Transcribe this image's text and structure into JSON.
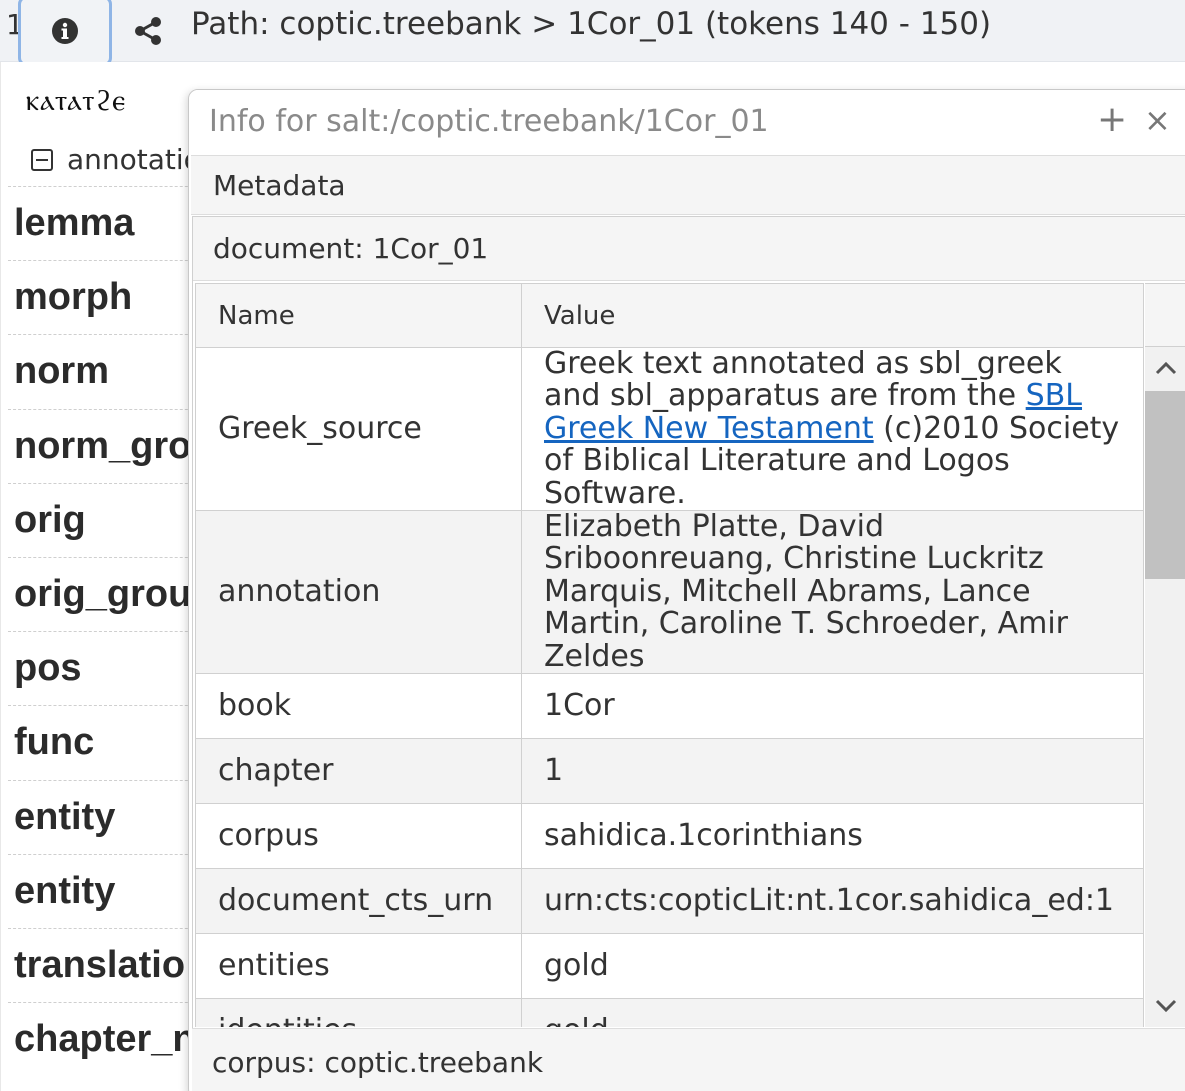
{
  "topbar": {
    "row_number": "1",
    "info_icon": "info-circle-icon",
    "share_icon": "share-icon",
    "path": "Path: coptic.treebank > 1Cor_01 (tokens 140 - 150)"
  },
  "left_panel": {
    "coptic_word": "ⲕⲁⲧⲁⲧϩⲉ",
    "annotations_label": "annotatio",
    "layers": [
      "lemma",
      "morph",
      "norm",
      "norm_gro",
      "orig",
      "orig_grou",
      "pos",
      "func",
      "entity",
      "entity",
      "translatio",
      "chapter_n"
    ]
  },
  "modal": {
    "title": "Info for salt:/coptic.treebank/1Cor_01",
    "plus_label": "+",
    "close_label": "×",
    "metadata_label": "Metadata",
    "document_label": "document: 1Cor_01",
    "corpus_label": "corpus: coptic.treebank",
    "table": {
      "headers": {
        "name": "Name",
        "value": "Value"
      },
      "greek_source": {
        "name": "Greek_source",
        "text_before": "Greek text annotated as sbl_greek and sbl_apparatus are from the ",
        "link_text": "SBL Greek New Testament",
        "text_after": " (c)2010 Society of Biblical Literature and Logos Software."
      },
      "rows": [
        {
          "name": "annotation",
          "value": "Elizabeth Platte, David Sriboonreuang, Christine Luckritz Marquis, Mitchell Abrams, Lance Martin, Caroline T. Schroeder, Amir Zeldes"
        },
        {
          "name": "book",
          "value": "1Cor"
        },
        {
          "name": "chapter",
          "value": "1"
        },
        {
          "name": "corpus",
          "value": "sahidica.1corinthians"
        },
        {
          "name": "document_cts_urn",
          "value": "urn:cts:copticLit:nt.1cor.sahidica_ed:1"
        },
        {
          "name": "entities",
          "value": "gold"
        },
        {
          "name": "identities",
          "value": "gold"
        }
      ]
    }
  }
}
